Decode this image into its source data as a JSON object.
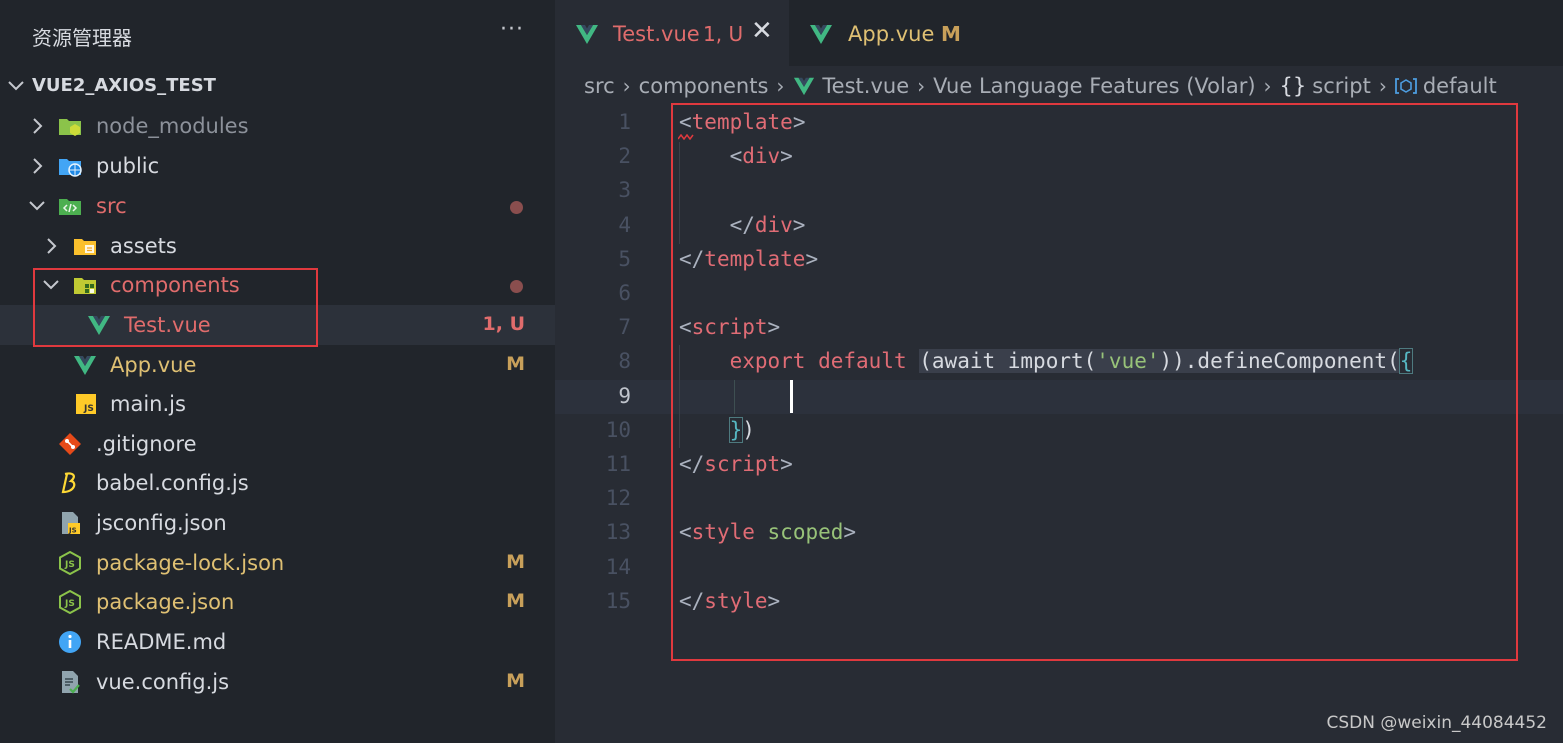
{
  "sidebar": {
    "title": "资源管理器",
    "more": "···",
    "root": "VUE2_AXIOS_TEST",
    "items": [
      {
        "name": "node_modules",
        "icon": "node-folder-icon"
      },
      {
        "name": "public",
        "icon": "public-folder-icon"
      },
      {
        "name": "src",
        "icon": "src-folder-icon"
      },
      {
        "name": "assets",
        "icon": "assets-folder-icon"
      },
      {
        "name": "components",
        "icon": "components-folder-icon"
      },
      {
        "name": "Test.vue",
        "icon": "vue-icon",
        "status": "1, U"
      },
      {
        "name": "App.vue",
        "icon": "vue-icon",
        "status": "M"
      },
      {
        "name": "main.js",
        "icon": "js-icon"
      },
      {
        "name": ".gitignore",
        "icon": "git-icon"
      },
      {
        "name": "babel.config.js",
        "icon": "babel-icon"
      },
      {
        "name": "jsconfig.json",
        "icon": "jsconfig-icon"
      },
      {
        "name": "package-lock.json",
        "icon": "node-json-icon",
        "status": "M"
      },
      {
        "name": "package.json",
        "icon": "node-json-icon",
        "status": "M"
      },
      {
        "name": "README.md",
        "icon": "info-icon"
      },
      {
        "name": "vue.config.js",
        "icon": "config-icon",
        "status": "M"
      }
    ]
  },
  "tabs": [
    {
      "name": "Test.vue",
      "status": "1, U",
      "close": "✕"
    },
    {
      "name": "App.vue",
      "status": "M"
    }
  ],
  "breadcrumb": [
    "src",
    "components",
    "Test.vue",
    "Vue Language Features (Volar)",
    "script",
    "default"
  ],
  "breadcrumb_glyphs": {
    "sep": "›",
    "braces": "{}"
  },
  "editor": {
    "line_numbers": [
      "1",
      "2",
      "3",
      "4",
      "5",
      "6",
      "7",
      "8",
      "9",
      "10",
      "11",
      "12",
      "13",
      "14",
      "15"
    ],
    "lines": [
      [
        "<",
        "template",
        ">"
      ],
      [
        "    <",
        "div",
        ">"
      ],
      [],
      [
        "    </",
        "div",
        ">"
      ],
      [
        "</",
        "template",
        ">"
      ],
      [],
      [
        "<",
        "script",
        ">"
      ],
      [
        "    ",
        "export",
        " ",
        "default",
        " ",
        "(await import(",
        "'vue'",
        ")).defineComponent(",
        "{"
      ],
      [],
      [
        "    ",
        "}",
        ")"
      ],
      [
        "</",
        "script",
        ">"
      ],
      [],
      [
        "<",
        "style",
        " ",
        "scoped",
        ">"
      ],
      [],
      [
        "</",
        "style",
        ">"
      ]
    ]
  },
  "watermark": "CSDN @weixin_44084452",
  "colors": {
    "highlight_box": "#e0393e",
    "vue_green": "#41b883",
    "git_untracked": "#e06c6c",
    "git_modified": "#c8a05a"
  }
}
